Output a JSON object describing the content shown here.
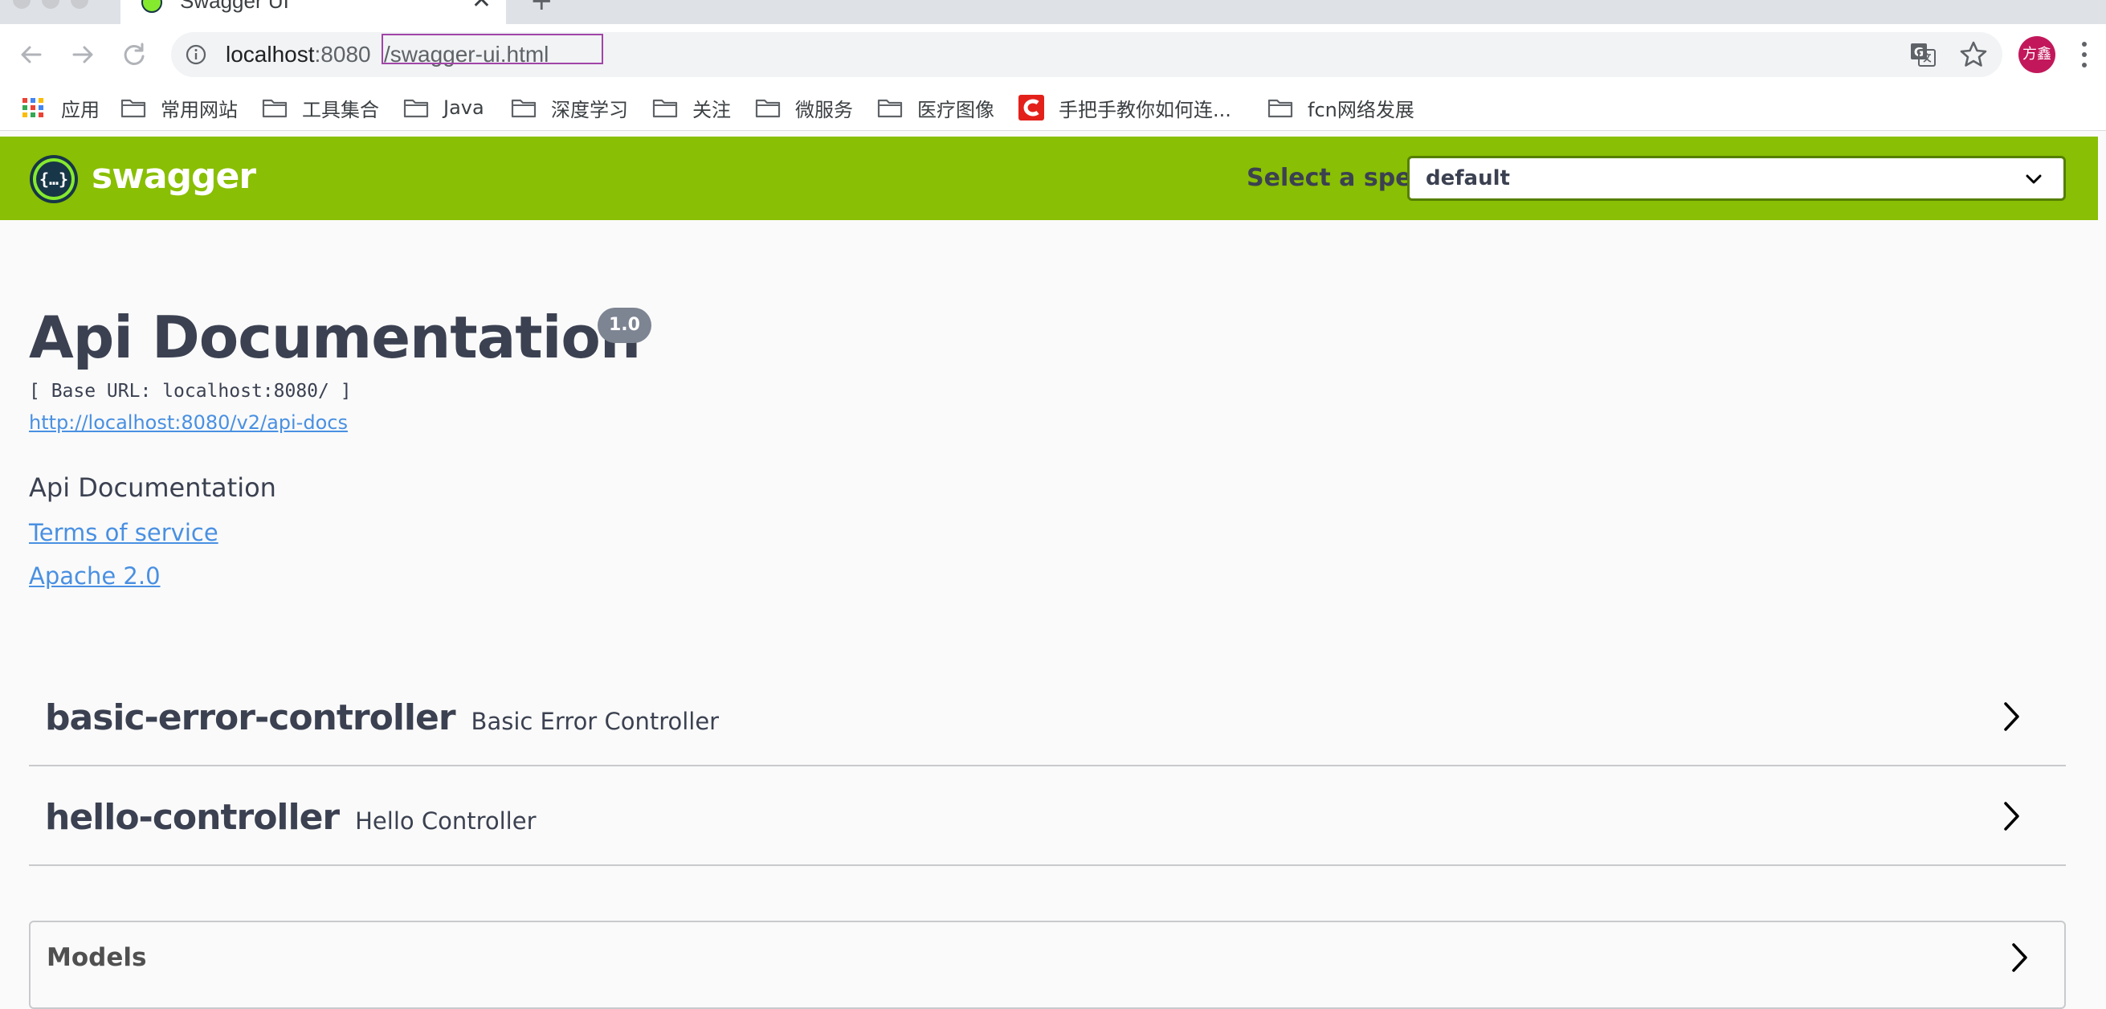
{
  "browser": {
    "tab_title": "Swagger UI",
    "new_tab_symbol": "+",
    "close_symbol": "✕",
    "url_host": "localhost",
    "url_port": ":8080",
    "url_path": "/swagger-ui.html",
    "profile_initials": "方鑫",
    "highlight_color": "#a145a8"
  },
  "bookmarks": [
    {
      "label": "应用",
      "icon": "apps-grid-icon"
    },
    {
      "label": "常用网站",
      "icon": "folder-icon"
    },
    {
      "label": "工具集合",
      "icon": "folder-icon"
    },
    {
      "label": "Java",
      "icon": "folder-icon"
    },
    {
      "label": "深度学习",
      "icon": "folder-icon"
    },
    {
      "label": "关注",
      "icon": "folder-icon"
    },
    {
      "label": "微服务",
      "icon": "folder-icon"
    },
    {
      "label": "医疗图像",
      "icon": "folder-icon"
    },
    {
      "label": "手把手教你如何连...",
      "icon": "csdn-icon"
    },
    {
      "label": "fcn网络发展",
      "icon": "folder-icon"
    }
  ],
  "topbar": {
    "logo_text": "swagger",
    "spec_label": "Select a spec",
    "spec_value": "default",
    "color": "#89bf04"
  },
  "info": {
    "title": "Api Documentation",
    "version": "1.0",
    "base_url": "[ Base URL: localhost:8080/ ]",
    "api_docs_url": "http://localhost:8080/v2/api-docs",
    "description": "Api Documentation",
    "terms": "Terms of service",
    "license": "Apache 2.0"
  },
  "tags": [
    {
      "name": "basic-error-controller",
      "description": "Basic Error Controller"
    },
    {
      "name": "hello-controller",
      "description": "Hello Controller"
    }
  ],
  "models": {
    "title": "Models"
  }
}
